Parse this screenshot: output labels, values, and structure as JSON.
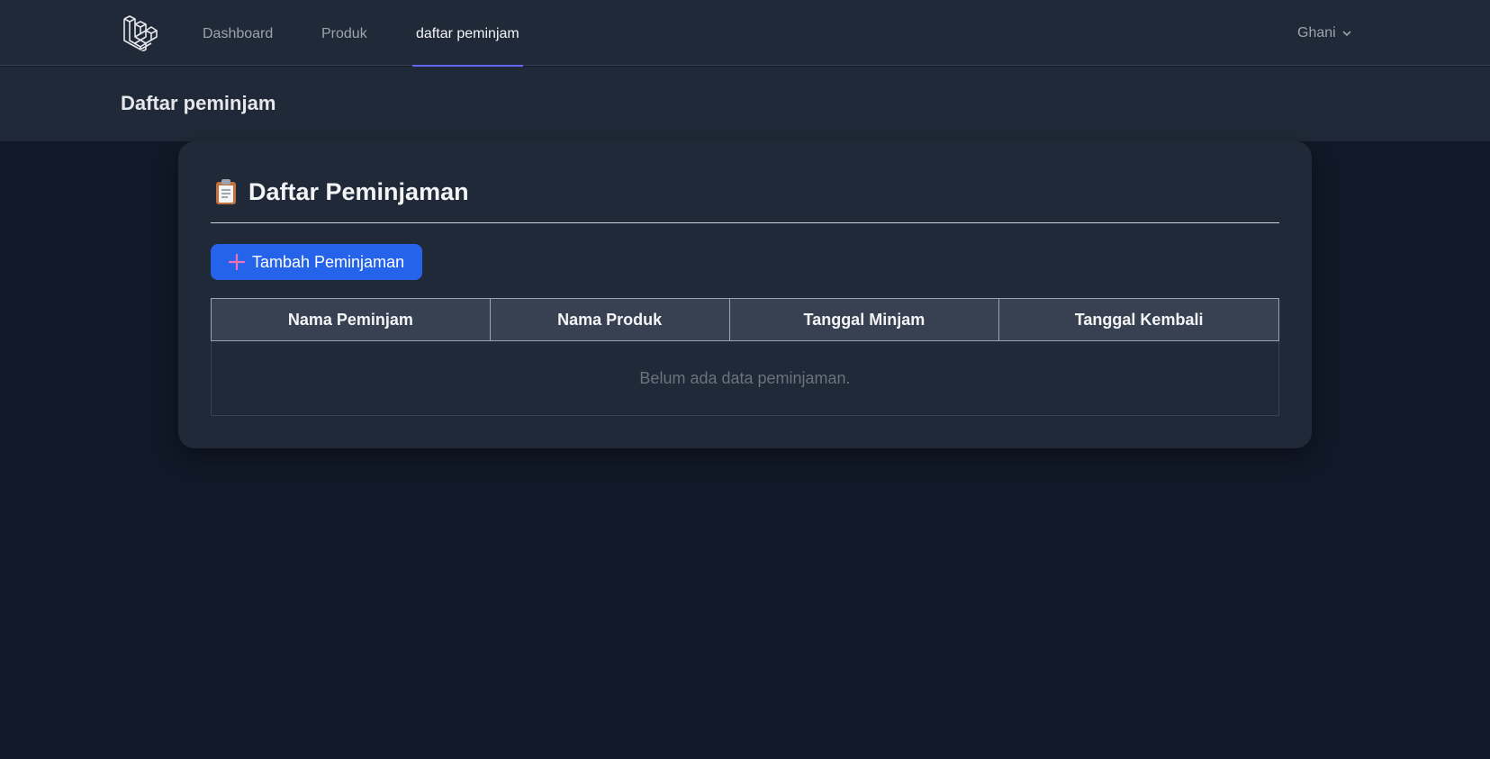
{
  "nav": {
    "links": [
      {
        "label": "Dashboard"
      },
      {
        "label": "Produk"
      },
      {
        "label": "daftar peminjam"
      }
    ],
    "user_name": "Ghani"
  },
  "header": {
    "title": "Daftar peminjam"
  },
  "card": {
    "title": "Daftar Peminjaman",
    "add_button_label": "Tambah Peminjaman",
    "table": {
      "columns": [
        "Nama Peminjam",
        "Nama Produk",
        "Tanggal Minjam",
        "Tanggal Kembali"
      ],
      "empty_message": "Belum ada data peminjaman."
    }
  },
  "colors": {
    "background": "#111827",
    "surface": "#1f2937",
    "accent_underline": "#6366f1",
    "primary_button": "#2563eb"
  },
  "icons": {
    "logo": "laravel-logo-icon",
    "card_title": "clipboard-icon",
    "add_button": "plus-icon",
    "user_menu": "chevron-down-icon"
  }
}
